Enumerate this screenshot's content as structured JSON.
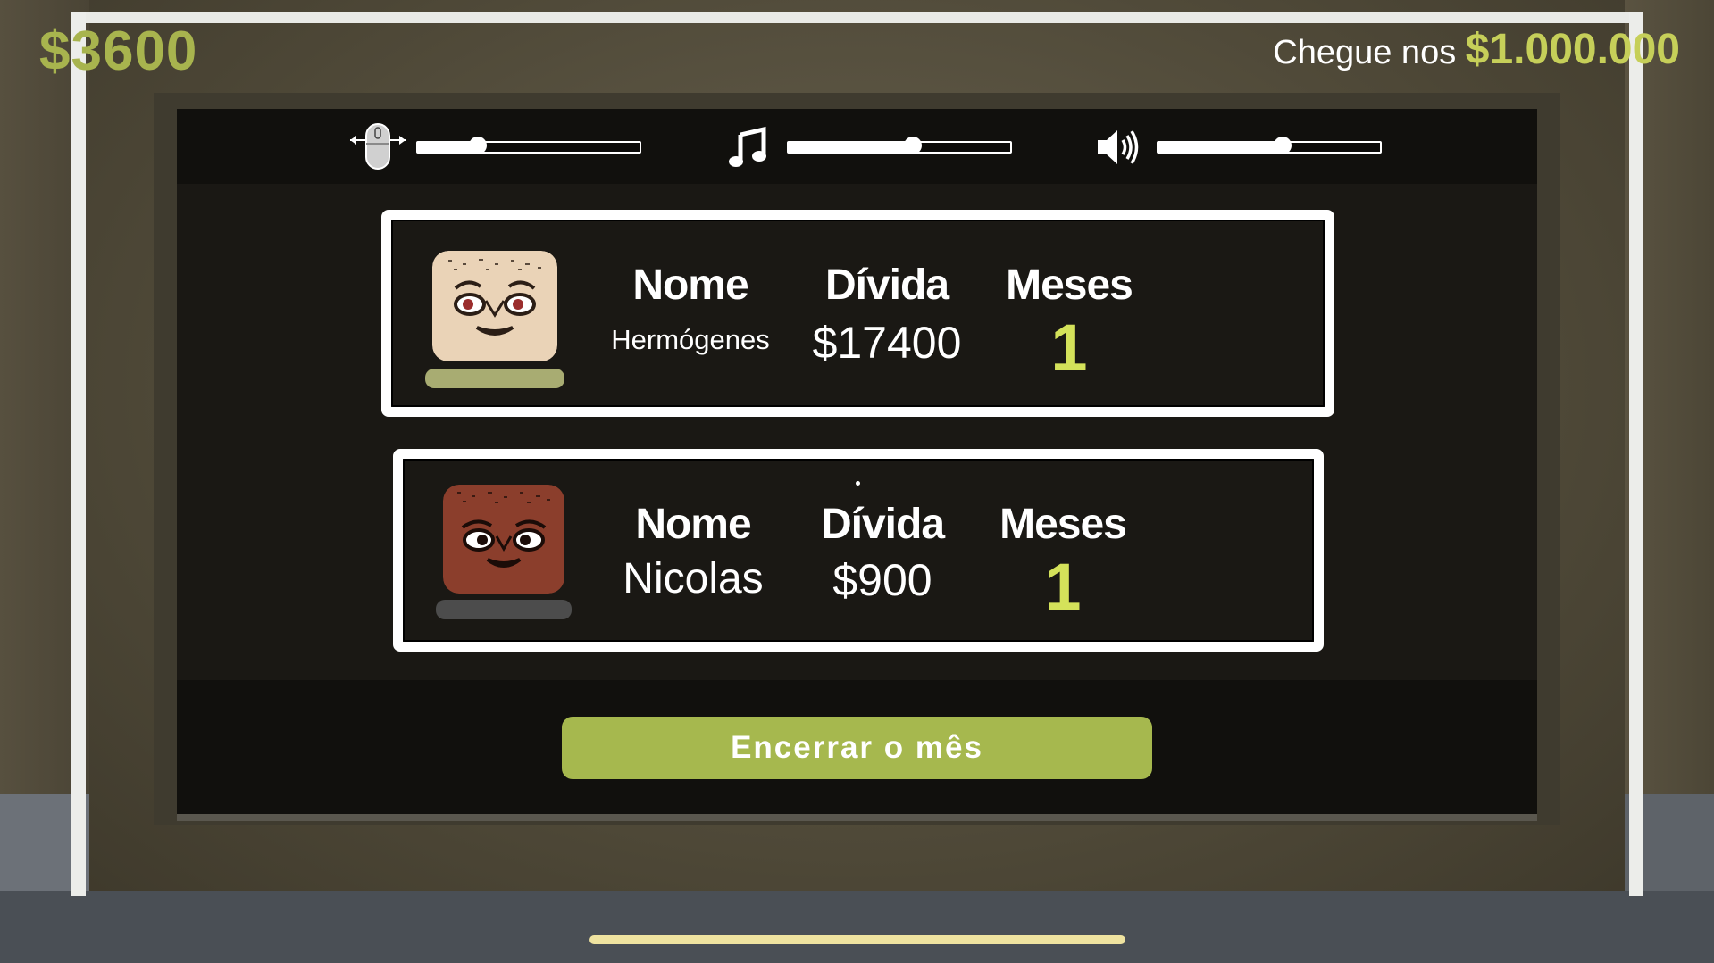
{
  "hud": {
    "money": "$3600",
    "goal_prefix": "Chegue nos",
    "goal_amount": "$1.000.000"
  },
  "settings": {
    "sensitivity": {
      "icon": "mouse-move-icon",
      "value": 0.27
    },
    "music": {
      "icon": "music-note-icon",
      "value": 0.56
    },
    "volume": {
      "icon": "speaker-icon",
      "value": 0.56
    }
  },
  "debtors": [
    {
      "avatar": "old-man-face-icon",
      "name_header": "Nome",
      "name": "Hermógenes",
      "debt_header": "Dívida",
      "debt": "$17400",
      "months_header": "Meses",
      "months": "1"
    },
    {
      "avatar": "dark-skin-face-icon",
      "name_header": "Nome",
      "name": "Nicolas",
      "debt_header": "Dívida",
      "debt": "$900",
      "months_header": "Meses",
      "months": "1"
    }
  ],
  "actions": {
    "end_month": "Encerrar o mês"
  },
  "colors": {
    "accent_green": "#a6b84e",
    "months_yellow": "#d4e25a",
    "screen_bg": "#1a1814"
  }
}
